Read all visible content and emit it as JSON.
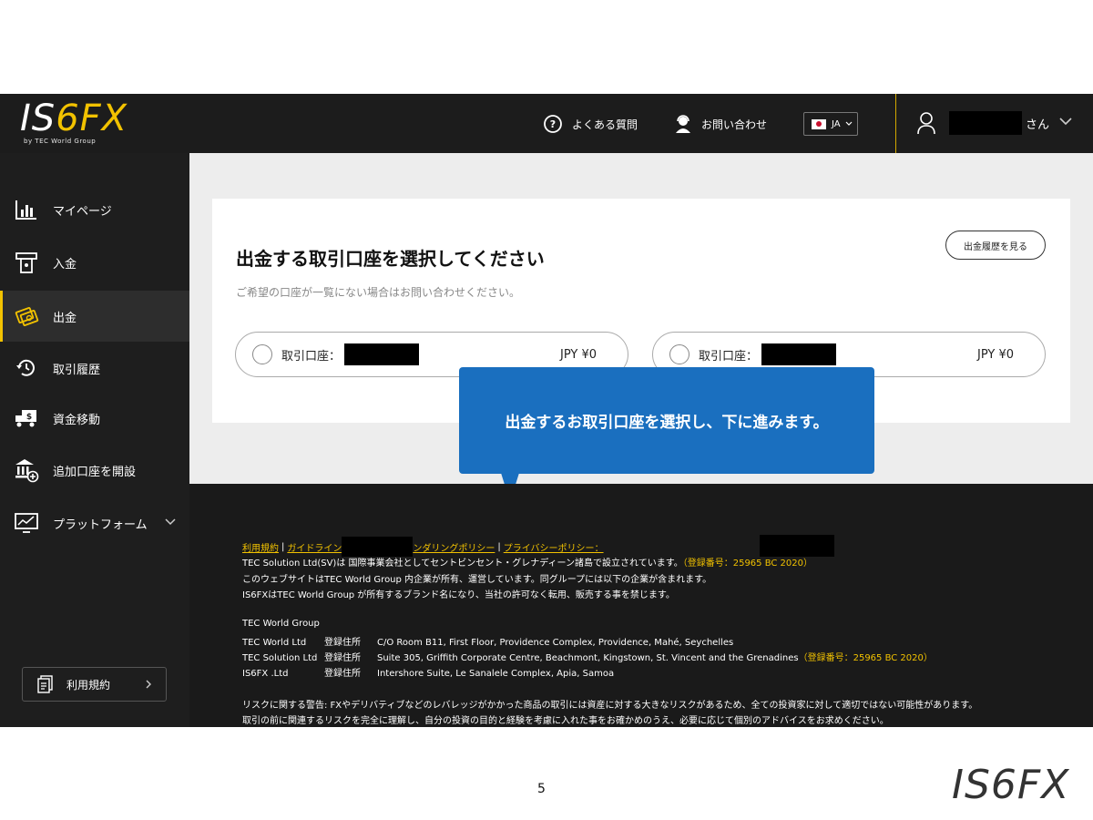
{
  "header": {
    "logo_text_a": "IS",
    "logo_text_b": "6FX",
    "logo_sub": "by TEC World Group",
    "faq_label": "よくある質問",
    "contact_label": "お問い合わせ",
    "lang_code": "JA",
    "user_suffix": "さん"
  },
  "sidebar": {
    "items": [
      {
        "label": "マイページ",
        "icon": "bar-chart-icon"
      },
      {
        "label": "入金",
        "icon": "atm-deposit-icon"
      },
      {
        "label": "出金",
        "icon": "cash-withdraw-icon"
      },
      {
        "label": "取引履歴",
        "icon": "history-icon"
      },
      {
        "label": "資金移動",
        "icon": "transfer-truck-icon"
      },
      {
        "label": "追加口座を開設",
        "icon": "bank-add-icon"
      },
      {
        "label": "プラットフォーム",
        "icon": "monitor-chart-icon"
      }
    ],
    "active_index": 2,
    "terms_label": "利用規約"
  },
  "main": {
    "title": "出金する取引口座を選択してください",
    "subtitle": "ご希望の口座が一覧にない場合はお問い合わせください。",
    "history_button": "出金履歴を見る",
    "accounts": [
      {
        "label": "取引口座：",
        "balance": "JPY ¥0"
      },
      {
        "label": "取引口座：",
        "balance": "JPY ¥0"
      }
    ]
  },
  "callout": {
    "text": "出金するお取引口座を選択し、下に進みます。"
  },
  "footer": {
    "links": [
      "利用規約",
      "ガイドライン",
      "ンダリングポリシー",
      "プライバシーポリシー"
    ],
    "link_tail": "：",
    "lines": [
      {
        "text": "TEC Solution Ltd(SV)は 国際事業会社としてセントビンセント・グレナディーン諸島で設立されています。",
        "highlight": "（登録番号：25965 BC 2020）"
      },
      {
        "text": "このウェブサイトはTEC World Group 内企業が所有、運営しています。同グループには以下の企業が含まれます。",
        "highlight": ""
      },
      {
        "text": "IS6FXはTEC World Group が所有するブランド名になり、当社の許可なく転用、販売する事を禁じます。",
        "highlight": ""
      }
    ],
    "group_title": "TEC World Group",
    "companies": [
      {
        "name": "TEC World Ltd",
        "type": "登録住所",
        "address": "C/O Room B11, First Floor, Providence Complex, Providence, Mahé, Seychelles",
        "highlight": ""
      },
      {
        "name": "TEC Solution Ltd",
        "type": "登録住所",
        "address": "Suite 305, Griffith Corporate Centre, Beachmont, Kingstown, St. Vincent and the Grenadines",
        "highlight": "（登録番号：25965 BC 2020）"
      },
      {
        "name": "IS6FX .Ltd",
        "type": "登録住所",
        "address": "Intershore Suite, Le Sanalele Complex, Apia, Samoa",
        "highlight": ""
      }
    ],
    "risk_1": "リスクに関する警告: FXやデリバティブなどのレバレッジがかかった商品の取引には資産に対する大きなリスクがあるため、全ての投資家に対して適切ではない可能性があります。",
    "risk_2": "取引の前に関連するリスクを完全に理解し、自分の投資の目的と経験を考慮に入れた事をお確かめのうえ、必要に応じて個別のアドバイスをお求めください。"
  },
  "slide": {
    "page_number": "5",
    "brand_mark": "IS6FX"
  },
  "colors": {
    "header_bg": "#1c1c1c",
    "accent_yellow": "#f2c200",
    "callout_blue": "#1a6fbf",
    "content_bg": "#ededed"
  }
}
